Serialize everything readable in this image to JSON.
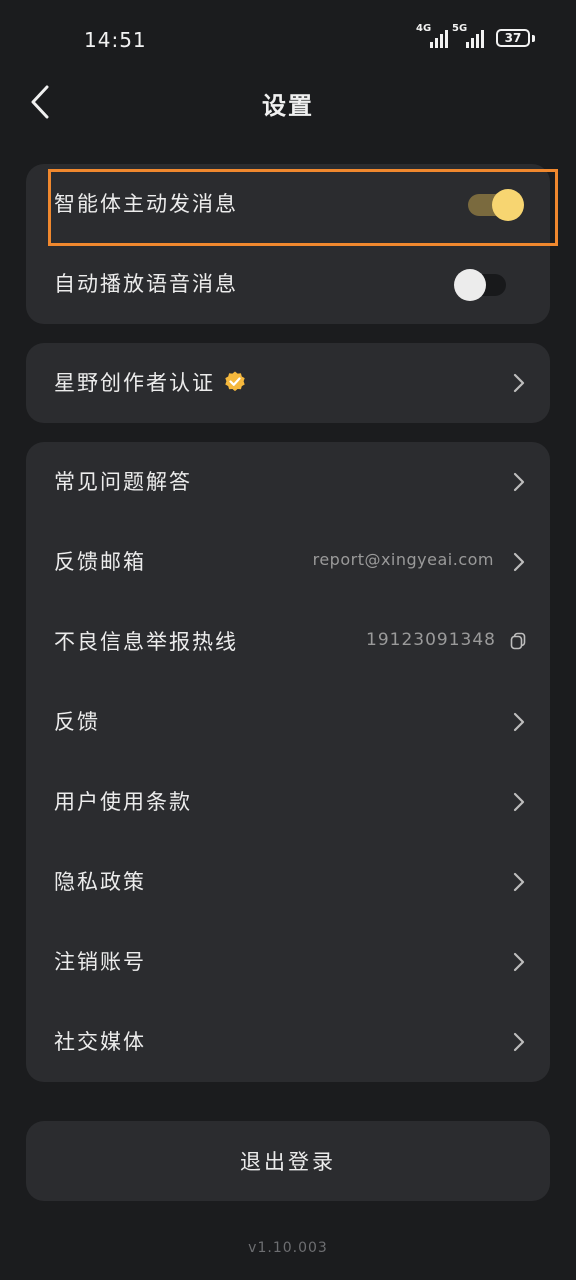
{
  "status_bar": {
    "time": "14:51",
    "signal_1": "4G",
    "signal_2": "5G",
    "battery": "37"
  },
  "header": {
    "title": "设置",
    "back_icon": "chevron-left-icon"
  },
  "toggles": [
    {
      "label": "智能体主动发消息",
      "state": "on",
      "highlighted": true
    },
    {
      "label": "自动播放语音消息",
      "state": "off"
    }
  ],
  "creator": {
    "label": "星野创作者认证",
    "badge_icon": "verified-badge-icon"
  },
  "menu": {
    "faq": "常见问题解答",
    "feedback_email_label": "反馈邮箱",
    "feedback_email_value": "report@xingyeai.com",
    "report_hotline_label": "不良信息举报热线",
    "report_hotline_value": "19123091348",
    "feedback": "反馈",
    "terms": "用户使用条款",
    "privacy": "隐私政策",
    "delete_account": "注销账号",
    "social_media": "社交媒体"
  },
  "logout_label": "退出登录",
  "version": "v1.10.003",
  "colors": {
    "background": "#1b1c1e",
    "card": "#2b2c2f",
    "toggle_on_knob": "#f7d571",
    "highlight": "#f0882e",
    "badge": "#f5b83d"
  }
}
